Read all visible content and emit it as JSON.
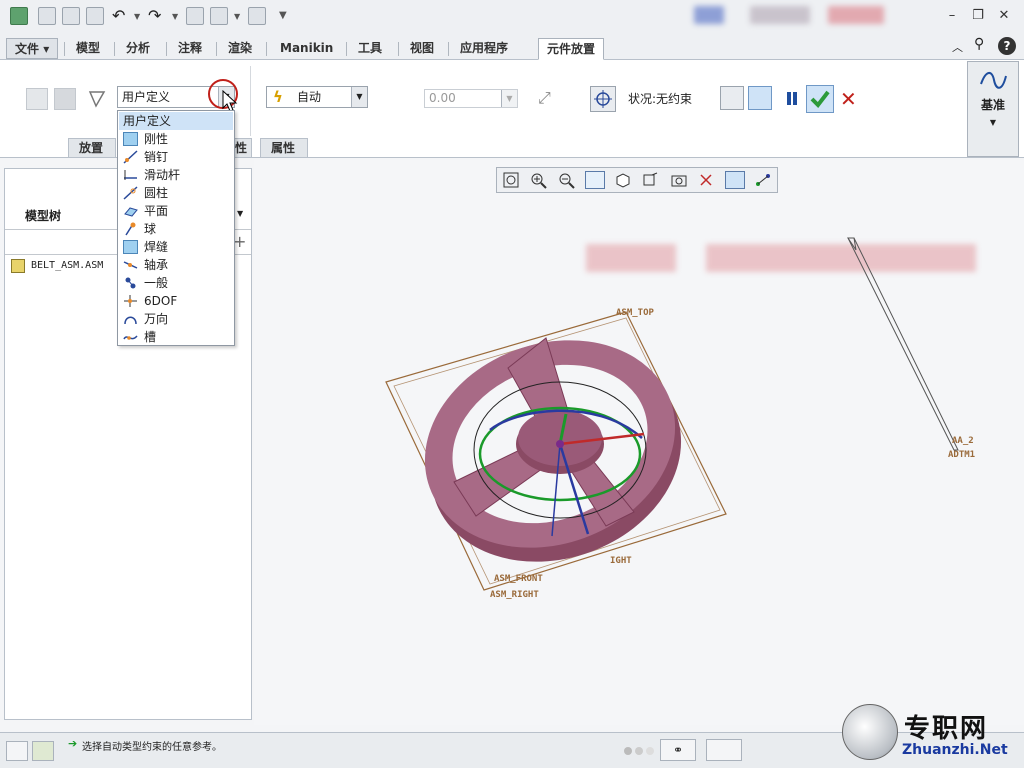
{
  "ribbon_tabs": [
    "文件",
    "模型",
    "分析",
    "注释",
    "渲染",
    "Manikin",
    "工具",
    "视图",
    "应用程序",
    "元件放置"
  ],
  "constraint_combo": {
    "value": "用户定义"
  },
  "auto_combo": {
    "value": "自动"
  },
  "offset_field": {
    "value": "0.00"
  },
  "status_label": "状况:无约束",
  "datum_button": {
    "label": "基准"
  },
  "groups": {
    "placement": "放置",
    "properties": "属性",
    "hidden_partial": "性"
  },
  "connection_types": [
    "用户定义",
    "刚性",
    "销钉",
    "滑动杆",
    "圆柱",
    "平面",
    "球",
    "焊缝",
    "轴承",
    "一般",
    "6DOF",
    "万向",
    "槽"
  ],
  "model_tree": {
    "title": "模型树",
    "root": "BELT_ASM.ASM"
  },
  "datum_labels": {
    "asm_top": "ASM_TOP",
    "asm_front": "ASM_FRONT",
    "asm_right": "ASM_RIGHT",
    "right_partial": "IGHT",
    "aa": "AA_2",
    "adtm": "ADTM1"
  },
  "status_message": "选择自动类型约束的任意参考。",
  "watermark": {
    "cn": "专职网",
    "url": "Zhuanzhi.Net"
  },
  "colors": {
    "accent": "#cfe3f7",
    "wheel": "#a0607a",
    "confirm": "#2c9a3a",
    "cancel": "#c0201a",
    "datum": "#9a6a3a"
  }
}
